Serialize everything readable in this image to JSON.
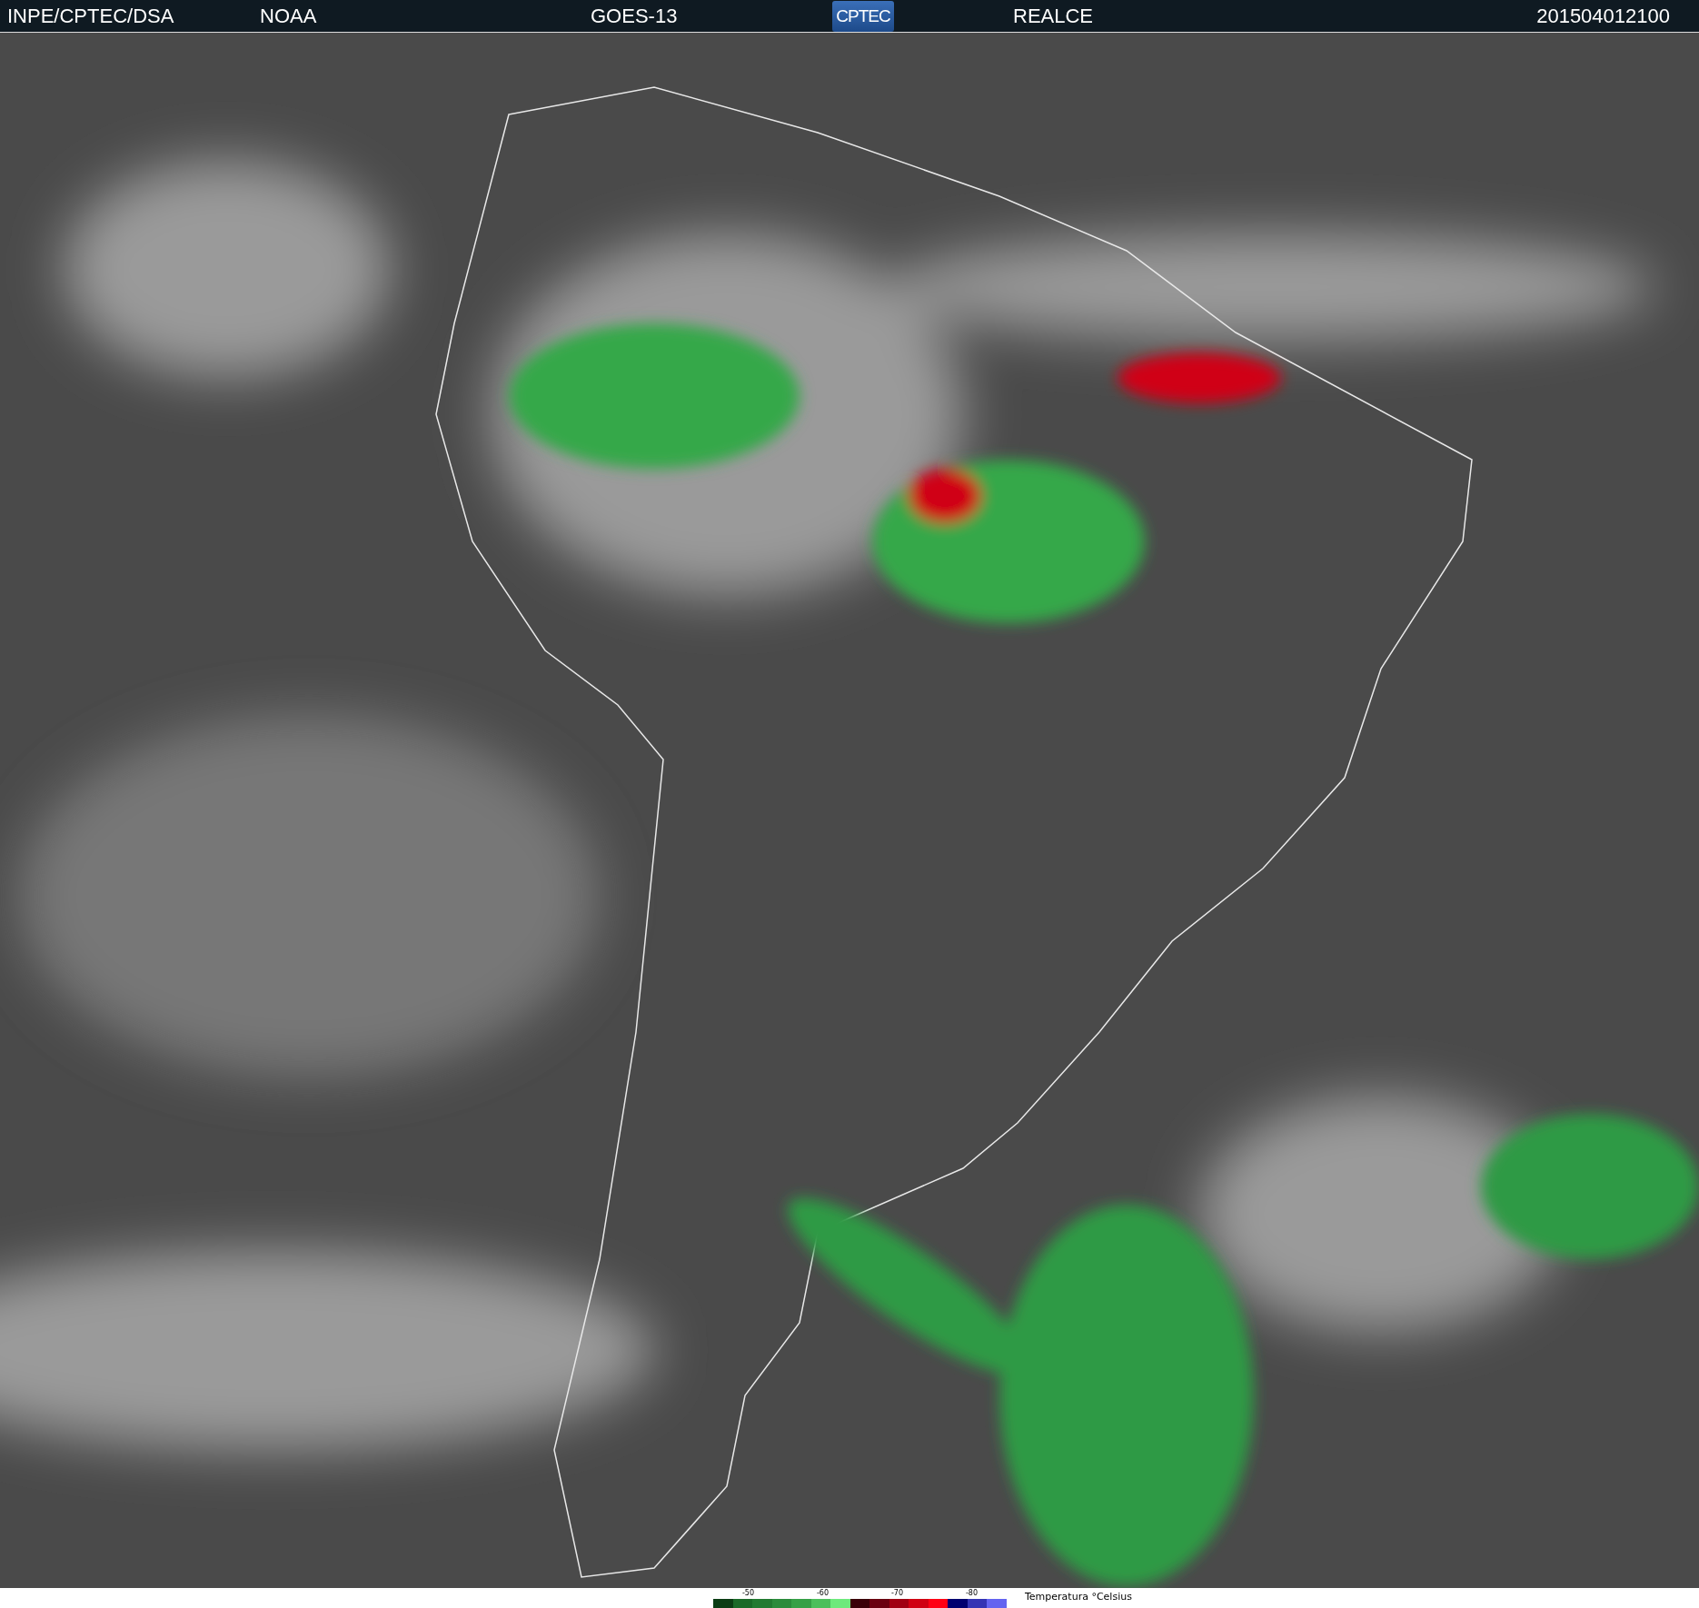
{
  "header": {
    "source": "INPE/CPTEC/DSA",
    "agency": "NOAA",
    "satellite": "GOES-13",
    "logo": "CPTEC",
    "product": "REALCE",
    "timestamp": "201504012100"
  },
  "legend": {
    "ticks": [
      "-50",
      "-60",
      "-70",
      "-80"
    ],
    "title": "Temperatura °Celsius",
    "swatches": [
      {
        "color": "#0b3d14"
      },
      {
        "color": "#1a6a28"
      },
      {
        "color": "#227a31"
      },
      {
        "color": "#2b8b3b"
      },
      {
        "color": "#36a046"
      },
      {
        "color": "#4cbf5b"
      },
      {
        "color": "#6ee97c"
      },
      {
        "color": "#3a0008"
      },
      {
        "color": "#6a0010"
      },
      {
        "color": "#a00012"
      },
      {
        "color": "#d00012"
      },
      {
        "color": "#ff0014"
      },
      {
        "color": "#000070"
      },
      {
        "color": "#3434b4"
      },
      {
        "color": "#6464f0"
      }
    ]
  }
}
